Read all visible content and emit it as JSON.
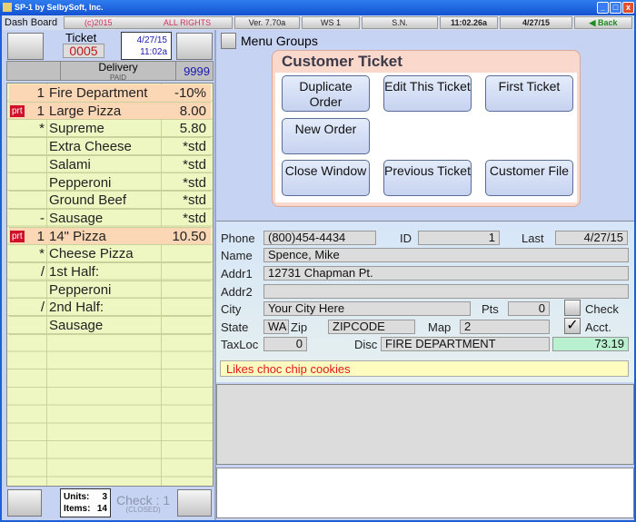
{
  "window": {
    "title": "SP-1 by SelbySoft, Inc."
  },
  "toolbar": {
    "tab": "Dash Board",
    "copyright": "(c)2015",
    "rights": "ALL RIGHTS RESERVED",
    "version": "Ver. 7.70a",
    "ws": "WS  1",
    "sn": "S.N.",
    "time": "11:02.26a",
    "date": "4/27/15",
    "back": "Back"
  },
  "ticket": {
    "label": "Ticket",
    "number": "0005",
    "date": "4/27/15",
    "time": "11:02a",
    "type": "Delivery",
    "status": "PAID",
    "code": "9999"
  },
  "order_items": [
    {
      "qty": "1",
      "name": "Fire Department",
      "price": "-10%",
      "highlight": true,
      "prt": false
    },
    {
      "qty": "1",
      "name": "Large Pizza",
      "price": "8.00",
      "highlight": true,
      "prt": true
    },
    {
      "qty": "*",
      "name": "Supreme",
      "price": "5.80"
    },
    {
      "qty": "",
      "name": "Extra Cheese",
      "price": "*std"
    },
    {
      "qty": "",
      "name": "Salami",
      "price": "*std"
    },
    {
      "qty": "",
      "name": "Pepperoni",
      "price": "*std"
    },
    {
      "qty": "",
      "name": "Ground Beef",
      "price": "*std"
    },
    {
      "qty": "-",
      "name": "Sausage",
      "price": "*std"
    },
    {
      "qty": "1",
      "name": "14\" Pizza",
      "price": "10.50",
      "highlight": true,
      "prt": true
    },
    {
      "qty": "*",
      "name": "Cheese Pizza",
      "price": ""
    },
    {
      "qty": "/",
      "name": "1st Half:",
      "price": ""
    },
    {
      "qty": "",
      "name": "Pepperoni",
      "price": ""
    },
    {
      "qty": "/",
      "name": "2nd Half:",
      "price": ""
    },
    {
      "qty": "",
      "name": "Sausage",
      "price": ""
    }
  ],
  "prt_label": "prt",
  "footer": {
    "units_label": "Units:",
    "units": "3",
    "items_label": "Items:",
    "items": "14",
    "check": "Check : 1",
    "check_status": "(CLOSED)"
  },
  "menu_groups": "Menu Groups",
  "customer_ticket": {
    "title": "Customer Ticket",
    "buttons": [
      "Duplicate Order",
      "Edit This Ticket",
      "First Ticket",
      "New Order",
      "Close Window",
      "Previous Ticket",
      "Customer File"
    ]
  },
  "customer": {
    "phone_label": "Phone",
    "phone": "(800)454-4434",
    "id_label": "ID",
    "id": "1",
    "last_label": "Last",
    "last": "4/27/15",
    "name_label": "Name",
    "name": "Spence, Mike",
    "addr1_label": "Addr1",
    "addr1": "12731 Chapman Pt.",
    "addr2_label": "Addr2",
    "addr2": "",
    "city_label": "City",
    "city": "Your City Here",
    "pts_label": "Pts",
    "pts": "0",
    "check_label": "Check",
    "check": false,
    "state_label": "State",
    "state": "WA",
    "zip_label": "Zip",
    "zip": "ZIPCODE",
    "map_label": "Map",
    "map": "2",
    "acct_label": "Acct.",
    "acct": true,
    "taxloc_label": "TaxLoc",
    "taxloc": "0",
    "disc_label": "Disc",
    "disc": "FIRE DEPARTMENT",
    "balance": "73.19",
    "note": "Likes choc chip cookies"
  }
}
